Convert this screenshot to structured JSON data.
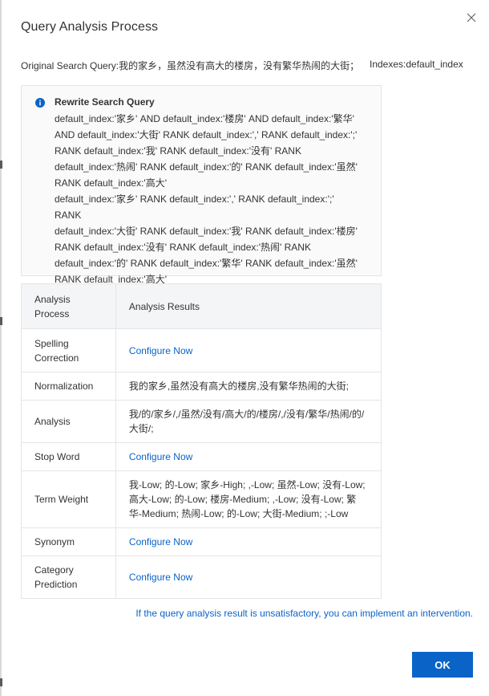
{
  "dialog": {
    "title": "Query Analysis Process",
    "original_query_label": "Original Search Query:",
    "original_query_value": "我的家乡，虽然没有高大的楼房，没有繁华热闹的大街；",
    "indexes_label": "Indexes:",
    "indexes_value": "default_index"
  },
  "rewrite": {
    "title": "Rewrite Search Query",
    "text": "default_index:'家乡' AND default_index:'楼房' AND default_index:'繁华'\nAND default_index:'大街' RANK default_index:',' RANK default_index:';'\nRANK default_index:'我' RANK default_index:'没有' RANK\ndefault_index:'热闹' RANK default_index:'的' RANK default_index:'虽然'\nRANK default_index:'高大'\ndefault_index:'家乡' RANK default_index:',' RANK default_index:';' RANK\ndefault_index:'大街' RANK default_index:'我' RANK default_index:'楼房'\nRANK default_index:'没有' RANK default_index:'热闹' RANK\ndefault_index:'的' RANK default_index:'繁华' RANK default_index:'虽然'\nRANK default_index:'高大'"
  },
  "table": {
    "headers": [
      "Analysis\nProcess",
      "Analysis Results"
    ],
    "rows": [
      {
        "process": "Spelling\nCorrection",
        "result": "Configure Now",
        "is_link": true
      },
      {
        "process": "Normalization",
        "result": "我的家乡,虽然没有高大的楼房,没有繁华热闹的大街;",
        "is_link": false
      },
      {
        "process": "Analysis",
        "result": "我/的/家乡/,/虽然/没有/高大/的/楼房/,/没有/繁华/热闹/的/大街/;",
        "is_link": false
      },
      {
        "process": "Stop Word",
        "result": "Configure Now",
        "is_link": true
      },
      {
        "process": "Term Weight",
        "result": "我-Low; 的-Low; 家乡-High; ,-Low; 虽然-Low; 没有-Low; 高大-Low; 的-Low; 楼房-Medium; ,-Low; 没有-Low; 繁华-Medium; 热闹-Low; 的-Low; 大街-Medium; ;-Low",
        "is_link": false
      },
      {
        "process": "Synonym",
        "result": "Configure Now",
        "is_link": true
      },
      {
        "process": "Category\nPrediction",
        "result": "Configure Now",
        "is_link": true
      }
    ]
  },
  "footer": {
    "note": "If the query analysis result is unsatisfactory, you can implement an intervention.",
    "ok_label": "OK"
  },
  "colors": {
    "accent": "#0a63c7",
    "header_bg": "#f4f5f7",
    "border": "#e5e5e5"
  }
}
